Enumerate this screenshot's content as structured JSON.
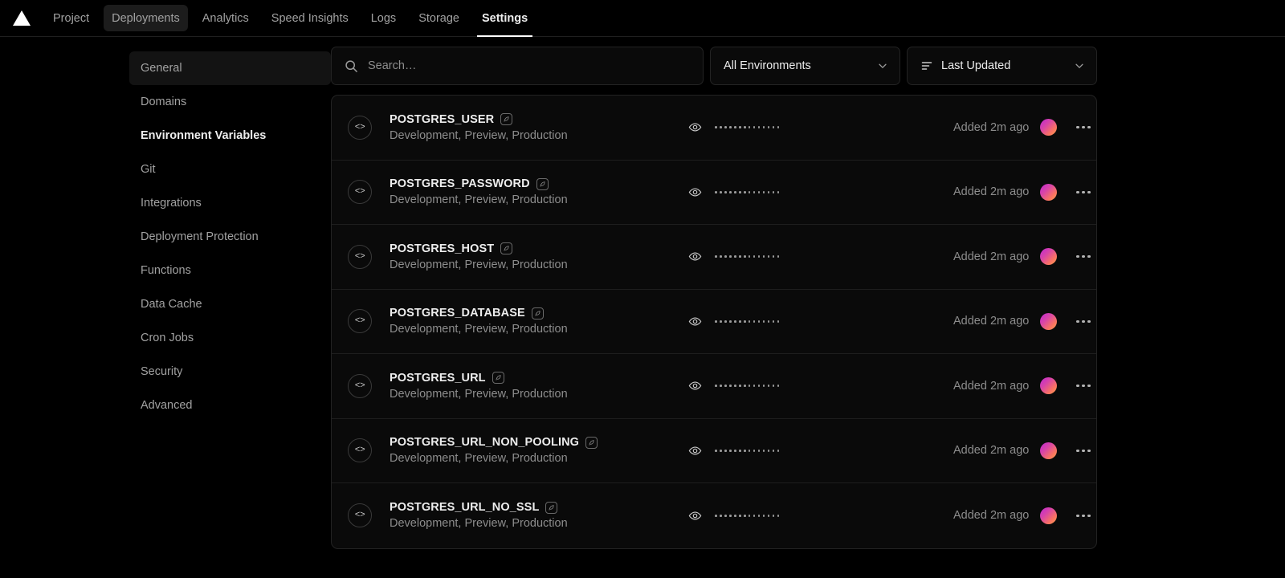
{
  "topnav": {
    "logo": "vercel-triangle-logo",
    "items": [
      {
        "label": "Project",
        "state": "default"
      },
      {
        "label": "Deployments",
        "state": "hover"
      },
      {
        "label": "Analytics",
        "state": "default"
      },
      {
        "label": "Speed Insights",
        "state": "default"
      },
      {
        "label": "Logs",
        "state": "default"
      },
      {
        "label": "Storage",
        "state": "default"
      },
      {
        "label": "Settings",
        "state": "active"
      }
    ]
  },
  "sidebar": {
    "items": [
      {
        "label": "General",
        "state": "hover"
      },
      {
        "label": "Domains",
        "state": "default"
      },
      {
        "label": "Environment Variables",
        "state": "active"
      },
      {
        "label": "Git",
        "state": "default"
      },
      {
        "label": "Integrations",
        "state": "default"
      },
      {
        "label": "Deployment Protection",
        "state": "default"
      },
      {
        "label": "Functions",
        "state": "default"
      },
      {
        "label": "Data Cache",
        "state": "default"
      },
      {
        "label": "Cron Jobs",
        "state": "default"
      },
      {
        "label": "Security",
        "state": "default"
      },
      {
        "label": "Advanced",
        "state": "default"
      }
    ]
  },
  "toolbar": {
    "search": {
      "placeholder": "Search…",
      "value": "",
      "icon": "search-icon"
    },
    "environment_filter": {
      "selected": "All Environments",
      "icon": "chevron-down-icon"
    },
    "sort": {
      "selected": "Last Updated",
      "icon": "sort-lines-icon",
      "chevron": "chevron-down-icon"
    }
  },
  "variables": [
    {
      "name": "POSTGRES_USER",
      "environments": "Development, Preview, Production",
      "value_masked": "••••••••••••••",
      "added": "Added 2m ago",
      "provider_icon": "postgres-provider-icon"
    },
    {
      "name": "POSTGRES_PASSWORD",
      "environments": "Development, Preview, Production",
      "value_masked": "••••••••••••••",
      "added": "Added 2m ago",
      "provider_icon": "postgres-provider-icon"
    },
    {
      "name": "POSTGRES_HOST",
      "environments": "Development, Preview, Production",
      "value_masked": "••••••••••••••",
      "added": "Added 2m ago",
      "provider_icon": "postgres-provider-icon"
    },
    {
      "name": "POSTGRES_DATABASE",
      "environments": "Development, Preview, Production",
      "value_masked": "••••••••••••••",
      "added": "Added 2m ago",
      "provider_icon": "postgres-provider-icon"
    },
    {
      "name": "POSTGRES_URL",
      "environments": "Development, Preview, Production",
      "value_masked": "••••••••••••••",
      "added": "Added 2m ago",
      "provider_icon": "postgres-provider-icon"
    },
    {
      "name": "POSTGRES_URL_NON_POOLING",
      "environments": "Development, Preview, Production",
      "value_masked": "••••••••••••••",
      "added": "Added 2m ago",
      "provider_icon": "postgres-provider-icon"
    },
    {
      "name": "POSTGRES_URL_NO_SSL",
      "environments": "Development, Preview, Production",
      "value_masked": "••••••••••••••",
      "added": "Added 2m ago",
      "provider_icon": "postgres-provider-icon"
    }
  ],
  "row_icons": {
    "code": "code-brackets-icon",
    "reveal": "eye-icon",
    "menu": "kebab-menu-icon",
    "avatar": "user-avatar"
  },
  "colors": {
    "background": "#000000",
    "surface": "#0a0a0a",
    "border": "#232323",
    "text_primary": "#ededed",
    "text_muted": "#8d8d8d",
    "avatar_gradient_start": "#c026d3",
    "avatar_gradient_end": "#f9a04f"
  }
}
